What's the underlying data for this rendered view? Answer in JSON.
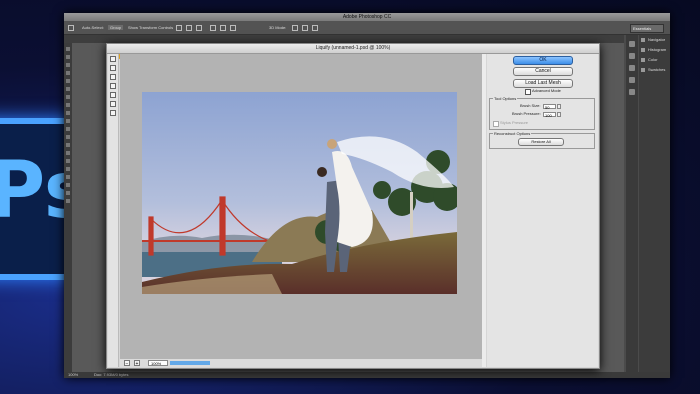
{
  "app": {
    "title": "Adobe Photoshop CC",
    "options": [
      "Auto-Select:",
      "Group",
      "Show Transform Controls",
      "3D Mode:"
    ],
    "preset": "Essentials",
    "panels": [
      "Navigator",
      "Histogram",
      "Color",
      "Swatches"
    ],
    "status_left": "100%",
    "status_doc": "Doc: 7.93M/0 bytes"
  },
  "dialog": {
    "title": "Liquify (unnamed-1.psd @ 100%)",
    "ok_label": "OK",
    "cancel_label": "Cancel",
    "load_mesh_label": "Load Last Mesh",
    "advanced_mode_label": "Advanced Mode",
    "tool_options_title": "Tool Options",
    "brush_size_label": "Brush Size:",
    "brush_size_value": "50",
    "brush_pressure_label": "Brush Pressure:",
    "brush_pressure_value": "100",
    "stylus_label": "Stylus Pressure",
    "reconstruct_title": "Reconstruct Options",
    "restore_all_label": "Restore All",
    "zoom_value": "100%",
    "zoom_minus": "−",
    "zoom_plus": "+"
  },
  "background": {
    "logo_text": "Ps"
  },
  "colors": {
    "accent": "#3d8ee8",
    "logo": "#4aa2ff"
  }
}
